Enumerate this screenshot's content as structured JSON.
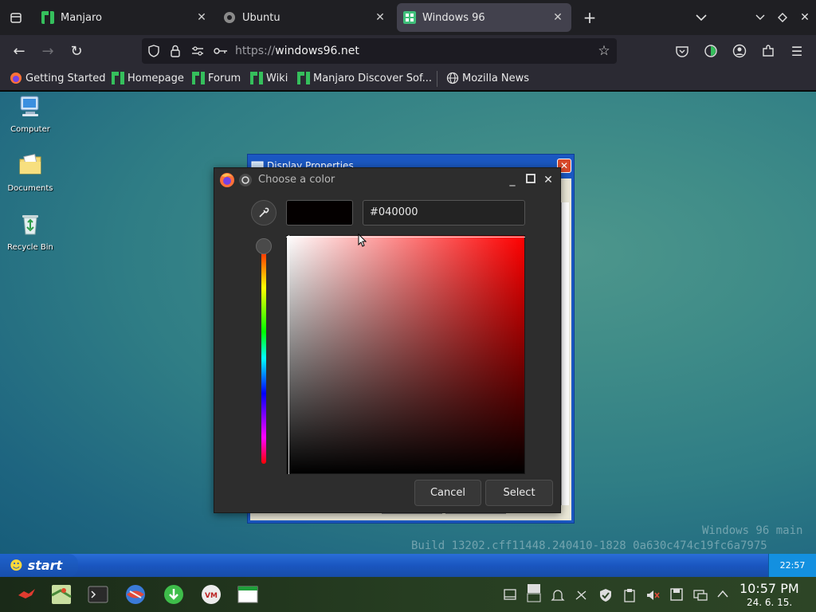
{
  "browser": {
    "tabs": [
      {
        "label": "Manjaro",
        "active": false
      },
      {
        "label": "Ubuntu",
        "active": false
      },
      {
        "label": "Windows 96",
        "active": true
      }
    ],
    "url_scheme": "https://",
    "url_host": "windows96.net",
    "bookmarks": [
      "Getting Started",
      "Homepage",
      "Forum",
      "Wiki",
      "Manjaro Discover Sof...",
      "Mozilla News"
    ]
  },
  "desktop": {
    "icons": [
      "Computer",
      "Documents",
      "Recycle Bin"
    ],
    "watermark_line1": "Windows 96 main",
    "watermark_line2": "Build 13202.cff11448.240410-1828 0a630c474c19fc6a7975"
  },
  "display_properties": {
    "title": "Display Properties",
    "close_label": "✕"
  },
  "color_dialog": {
    "title": "Choose a color",
    "hex_value": "#040000",
    "current_color": "#040000",
    "hue_color": "#ff0000",
    "cancel_label": "Cancel",
    "select_label": "Select"
  },
  "w96_taskbar": {
    "start_label": "start",
    "clock": "22:57"
  },
  "kde_panel": {
    "time": "10:57 PM",
    "date": "24. 6. 15."
  },
  "colors": {
    "tab_active": "#42414d",
    "manjaro_green": "#35bf5c",
    "win96_blue": "#1a56c0"
  }
}
